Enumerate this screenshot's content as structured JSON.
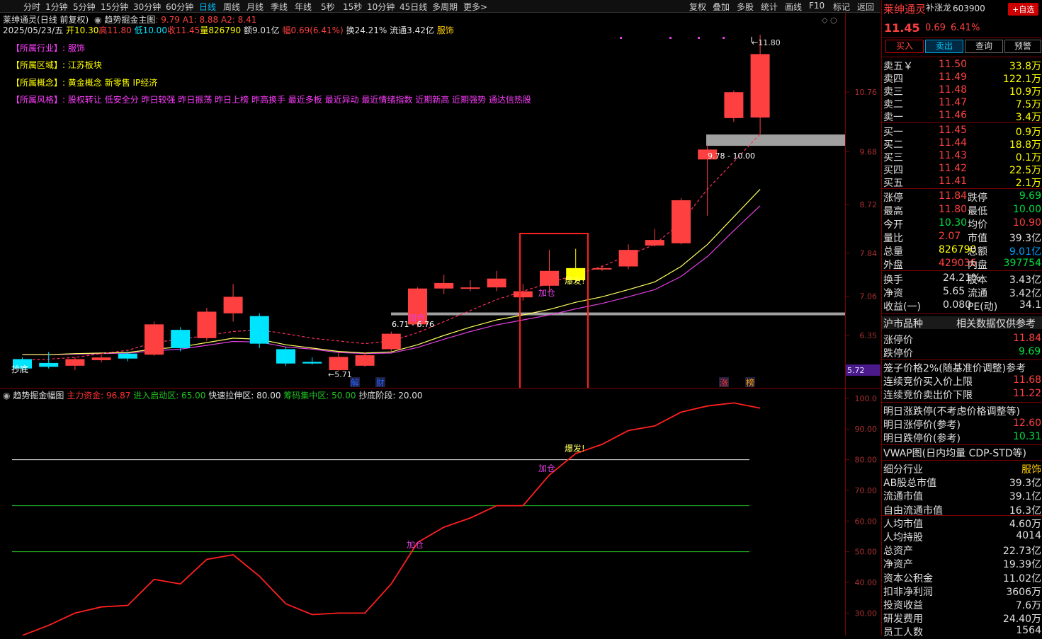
{
  "toolbar": {
    "periods": [
      "分时",
      "1分钟",
      "5分钟",
      "15分钟",
      "30分钟",
      "60分钟",
      "日线",
      "周线",
      "月线",
      "季线",
      "年线",
      "5秒",
      "15秒",
      "10分钟",
      "45日线",
      "多周期",
      "更多>"
    ],
    "active_period": "日线",
    "tools": [
      "复权",
      "叠加",
      "多股",
      "统计",
      "画线",
      "F10",
      "标记",
      "返回"
    ]
  },
  "header": {
    "stock_name": "莱绅通灵",
    "mode": "(日线 前复权)",
    "indicator_name": "趋势掘金主图",
    "params": ": 9.79  A1: 8.88  A2: 8.41",
    "date": "2025/05/23/五",
    "open": "开10.30",
    "high": "高11.80",
    "low": "低10.00",
    "close": "收11.45",
    "volume": "量826790",
    "amount": "额9.01亿",
    "change": "幅0.69(6.41%)",
    "turnover": "换24.21%",
    "float": "流通3.42亿",
    "sector": "服饰"
  },
  "info_tags": {
    "industry_label": "【所属行业】:",
    "industry": "服饰",
    "region_label": "【所属区域】:",
    "region": "江苏板块",
    "concept_label": "【所属概念】:",
    "concept": "黄金概念 新零售 IP经济",
    "style_label": "【所属风格】:",
    "style": "股权转让 低安全分 昨日较强 昨日振荡 昨日上榜 昨高换手 最近多板 最近异动 最近情绪指数 近期新高 近期强势 通达信热股"
  },
  "chart_data": [
    {
      "type": "candlestick",
      "title": "趋势掘金主图",
      "y_ticks": [
        "10.76",
        "9.68",
        "8.72",
        "7.84",
        "7.06",
        "6.35"
      ],
      "ylim": [
        5.4,
        12.2
      ],
      "candles": [
        {
          "o": 5.92,
          "c": 5.75,
          "h": 5.95,
          "l": 5.7
        },
        {
          "o": 5.85,
          "c": 5.78,
          "h": 6.05,
          "l": 5.75
        },
        {
          "o": 5.8,
          "c": 5.92,
          "h": 5.95,
          "l": 5.72
        },
        {
          "o": 5.9,
          "c": 5.95,
          "h": 6.0,
          "l": 5.86
        },
        {
          "o": 6.02,
          "c": 5.93,
          "h": 6.06,
          "l": 5.88
        },
        {
          "o": 6.0,
          "c": 6.55,
          "h": 6.6,
          "l": 5.98
        },
        {
          "o": 6.45,
          "c": 6.12,
          "h": 6.5,
          "l": 6.06
        },
        {
          "o": 6.3,
          "c": 6.78,
          "h": 6.85,
          "l": 6.25
        },
        {
          "o": 6.75,
          "c": 7.05,
          "h": 7.28,
          "l": 6.6
        },
        {
          "o": 6.7,
          "c": 6.2,
          "h": 6.75,
          "l": 6.12
        },
        {
          "o": 6.1,
          "c": 5.84,
          "h": 6.14,
          "l": 5.8
        },
        {
          "o": 5.87,
          "c": 5.84,
          "h": 5.95,
          "l": 5.82
        },
        {
          "o": 5.72,
          "c": 5.96,
          "h": 6.05,
          "l": 5.71
        },
        {
          "o": 5.8,
          "c": 5.99,
          "h": 6.04,
          "l": 5.78
        },
        {
          "o": 6.1,
          "c": 6.38,
          "h": 6.42,
          "l": 6.06
        },
        {
          "o": 6.55,
          "c": 7.2,
          "h": 7.22,
          "l": 6.5
        },
        {
          "o": 7.2,
          "c": 7.3,
          "h": 7.45,
          "l": 7.1
        },
        {
          "o": 7.22,
          "c": 7.22,
          "h": 7.35,
          "l": 7.15
        },
        {
          "o": 7.22,
          "c": 7.38,
          "h": 7.52,
          "l": 7.15
        },
        {
          "o": 7.04,
          "c": 7.15,
          "h": 7.28,
          "l": 6.98
        },
        {
          "o": 7.25,
          "c": 7.52,
          "h": 7.9,
          "l": 7.16
        },
        {
          "o": 7.35,
          "c": 7.57,
          "h": 7.92,
          "l": 7.3
        },
        {
          "o": 7.56,
          "c": 7.57,
          "h": 7.62,
          "l": 7.52
        },
        {
          "o": 7.6,
          "c": 7.9,
          "h": 8.0,
          "l": 7.55
        },
        {
          "o": 7.98,
          "c": 8.08,
          "h": 8.28,
          "l": 7.96
        },
        {
          "o": 8.02,
          "c": 8.8,
          "h": 8.84,
          "l": 8.0
        },
        {
          "o": 9.54,
          "c": 9.72,
          "h": 9.8,
          "l": 8.52
        },
        {
          "o": 10.29,
          "c": 10.76,
          "h": 10.79,
          "l": 10.22
        },
        {
          "o": 10.3,
          "c": 11.45,
          "h": 11.8,
          "l": 10.0
        }
      ],
      "candle_colors": {
        "up": "#ff4040",
        "down": "#00e5ff",
        "special": "#ffff00"
      },
      "special_candle_index": 21,
      "ma_short": [
        5.9,
        5.92,
        5.95,
        6.02,
        6.08,
        6.22,
        6.28,
        6.35,
        6.42,
        6.45,
        6.38,
        6.3,
        6.25,
        6.2,
        6.25,
        6.4,
        6.6,
        6.8,
        7.0,
        7.15,
        7.3,
        7.45,
        7.6,
        7.8,
        8.0,
        8.4,
        9.0,
        9.5,
        10.0
      ],
      "ma_mid": [
        6.0,
        6.0,
        6.02,
        6.03,
        6.04,
        6.1,
        6.14,
        6.22,
        6.3,
        6.28,
        6.18,
        6.12,
        6.06,
        6.03,
        6.05,
        6.18,
        6.35,
        6.5,
        6.63,
        6.72,
        6.82,
        6.95,
        7.05,
        7.18,
        7.32,
        7.6,
        8.0,
        8.5,
        9.0
      ],
      "ma_long": [
        6.0,
        6.0,
        6.01,
        6.02,
        6.03,
        6.07,
        6.1,
        6.17,
        6.24,
        6.23,
        6.14,
        6.1,
        6.04,
        6.02,
        6.03,
        6.13,
        6.28,
        6.42,
        6.54,
        6.63,
        6.72,
        6.83,
        6.93,
        7.05,
        7.18,
        7.42,
        7.78,
        8.25,
        8.7
      ],
      "annotations": {
        "bottom_signal": "抄底",
        "low_mark": "5.71",
        "add_position_1": "加仓",
        "add_position_2": "加仓",
        "breakout": "爆发!",
        "zone_1": "6.71 - 6.76",
        "zone_2": "9.78 - 10.00",
        "high_mark": "11.80",
        "current_price": "5.72",
        "event_jie": "解",
        "event_cai": "财",
        "event_zhang": "涨",
        "event_bang": "榜"
      }
    },
    {
      "type": "line",
      "title": "趋势掘金幅图",
      "legend": [
        {
          "label": "主力资金: 96.87",
          "color": "#ff3030"
        },
        {
          "label": "进入启动区: 65.00",
          "color": "#20c020"
        },
        {
          "label": "快速拉伸区: 80.00",
          "color": "#e0e0e0"
        },
        {
          "label": "筹码集中区: 50.00",
          "color": "#20c020"
        },
        {
          "label": "抄底阶段: 20.00",
          "color": "#e0e0e0"
        }
      ],
      "y_ticks": [
        "100.0",
        "90.00",
        "80.00",
        "70.00",
        "60.00",
        "50.00",
        "40.00",
        "30.00"
      ],
      "ylim": [
        22.7,
        103.2
      ],
      "reference_lines": [
        {
          "value": 80,
          "color": "#e8e8e8"
        },
        {
          "value": 65,
          "color": "#20c020"
        },
        {
          "value": 50,
          "color": "#20c020"
        }
      ],
      "values": [
        22.7,
        26,
        30,
        32,
        32.5,
        41,
        39.5,
        47.5,
        49,
        42,
        33,
        29.5,
        30,
        30,
        39.5,
        53,
        58,
        61,
        65,
        65,
        75,
        82,
        85,
        89.5,
        91,
        95.5,
        97.5,
        98.5,
        96.8
      ],
      "annotations": {
        "add_1": "加仓",
        "add_2": "加仓",
        "breakout": "爆发!"
      }
    }
  ],
  "quote_panel": {
    "name": "莱绅通灵",
    "tag": "补涨龙",
    "code": "603900",
    "add_watch": "+自选",
    "price": "11.45",
    "change": "0.69",
    "change_pct": "6.41%",
    "buttons": [
      "买入",
      "卖出",
      "查询",
      "预警"
    ],
    "sell": [
      {
        "label": "卖五",
        "price": "11.50",
        "vol": "33.8万"
      },
      {
        "label": "卖四",
        "price": "11.49",
        "vol": "122.1万"
      },
      {
        "label": "卖三",
        "price": "11.48",
        "vol": "10.9万"
      },
      {
        "label": "卖二",
        "price": "11.47",
        "vol": "7.5万"
      },
      {
        "label": "卖一",
        "price": "11.46",
        "vol": "3.4万"
      }
    ],
    "buy": [
      {
        "label": "买一",
        "price": "11.45",
        "vol": "0.9万"
      },
      {
        "label": "买二",
        "price": "11.44",
        "vol": "18.8万"
      },
      {
        "label": "买三",
        "price": "11.43",
        "vol": "0.1万"
      },
      {
        "label": "买四",
        "price": "11.42",
        "vol": "22.5万"
      },
      {
        "label": "买五",
        "price": "11.41",
        "vol": "2.1万"
      }
    ],
    "stats": [
      {
        "l1": "涨停",
        "v1": "11.84",
        "l2": "跌停",
        "v2": "9.69"
      },
      {
        "l1": "最高",
        "v1": "11.80",
        "l2": "最低",
        "v2": "10.00"
      },
      {
        "l1": "今开",
        "v1": "10.30",
        "l2": "均价",
        "v2": "10.90"
      },
      {
        "l1": "量比",
        "v1": "2.07",
        "l2": "市值",
        "v2": "39.3亿"
      },
      {
        "l1": "总量",
        "v1": "826790",
        "l2": "总额",
        "v2": "9.01亿"
      },
      {
        "l1": "外盘",
        "v1": "429036",
        "l2": "内盘",
        "v2": "397754"
      }
    ],
    "finance": [
      {
        "l1": "换手",
        "v1": "24.21%",
        "l2": "股本",
        "v2": "3.43亿"
      },
      {
        "l1": "净资",
        "v1": "5.65",
        "l2": "流通",
        "v2": "3.42亿"
      },
      {
        "l1": "收益(一)",
        "v1": "0.080",
        "l2": "PE(动)",
        "v2": "34.1"
      }
    ],
    "market_header_left": "沪市品种",
    "market_header_right": "相关数据仅供参考",
    "limit_up_label": "涨停价",
    "limit_up_value": "11.84",
    "limit_down_label": "跌停价",
    "limit_down_value": "9.69",
    "cage_label": "笼子价格2%(随基准价调整)参考",
    "cage_buy_label": "连续竞价买入价上限",
    "cage_buy_value": "11.68",
    "cage_sell_label": "连续竞价卖出价下限",
    "cage_sell_value": "11.22",
    "tomorrow_label": "明日涨跌停(不考虑价格调整等)",
    "tomorrow_up_label": "明日涨停价(参考)",
    "tomorrow_up_value": "12.60",
    "tomorrow_down_label": "明日跌停价(参考)",
    "tomorrow_down_value": "10.31",
    "vwap_label": "VWAP图(日内均量 CDP-STD等)",
    "details": [
      {
        "label": "细分行业",
        "value": "服饰"
      },
      {
        "label": "AB股总市值",
        "value": "39.3亿"
      },
      {
        "label": "流通市值",
        "value": "39.1亿"
      },
      {
        "label": "自由流通市值",
        "value": "16.3亿"
      },
      {
        "label": "人均市值",
        "value": "4.60万"
      },
      {
        "label": "人均持股",
        "value": "4014"
      },
      {
        "label": "总资产",
        "value": "22.73亿"
      },
      {
        "label": "净资产",
        "value": "19.39亿"
      },
      {
        "label": "资本公积金",
        "value": "11.02亿"
      },
      {
        "label": "扣非净利润",
        "value": "3606万"
      },
      {
        "label": "投资收益",
        "value": "7.6万"
      },
      {
        "label": "研发费用",
        "value": "24.40万"
      },
      {
        "label": "员工人数",
        "value": "1564"
      }
    ]
  }
}
